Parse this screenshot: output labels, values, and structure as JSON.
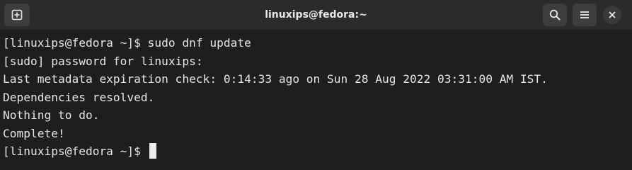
{
  "window": {
    "title": "linuxips@fedora:~"
  },
  "titlebar": {
    "new_tab_icon": "new-tab-plus-icon",
    "search_icon": "search-icon",
    "menu_icon": "hamburger-menu-icon",
    "close_icon": "close-icon"
  },
  "terminal": {
    "lines": [
      "[linuxips@fedora ~]$ sudo dnf update",
      "[sudo] password for linuxips:",
      "Last metadata expiration check: 0:14:33 ago on Sun 28 Aug 2022 03:31:00 AM IST.",
      "Dependencies resolved.",
      "Nothing to do.",
      "Complete!"
    ],
    "prompt": "[linuxips@fedora ~]$ "
  },
  "colors": {
    "background": "#1e1e1e",
    "titlebar": "#2b2b2b",
    "text": "#e6e6e6",
    "button": "#3d3d3d"
  }
}
